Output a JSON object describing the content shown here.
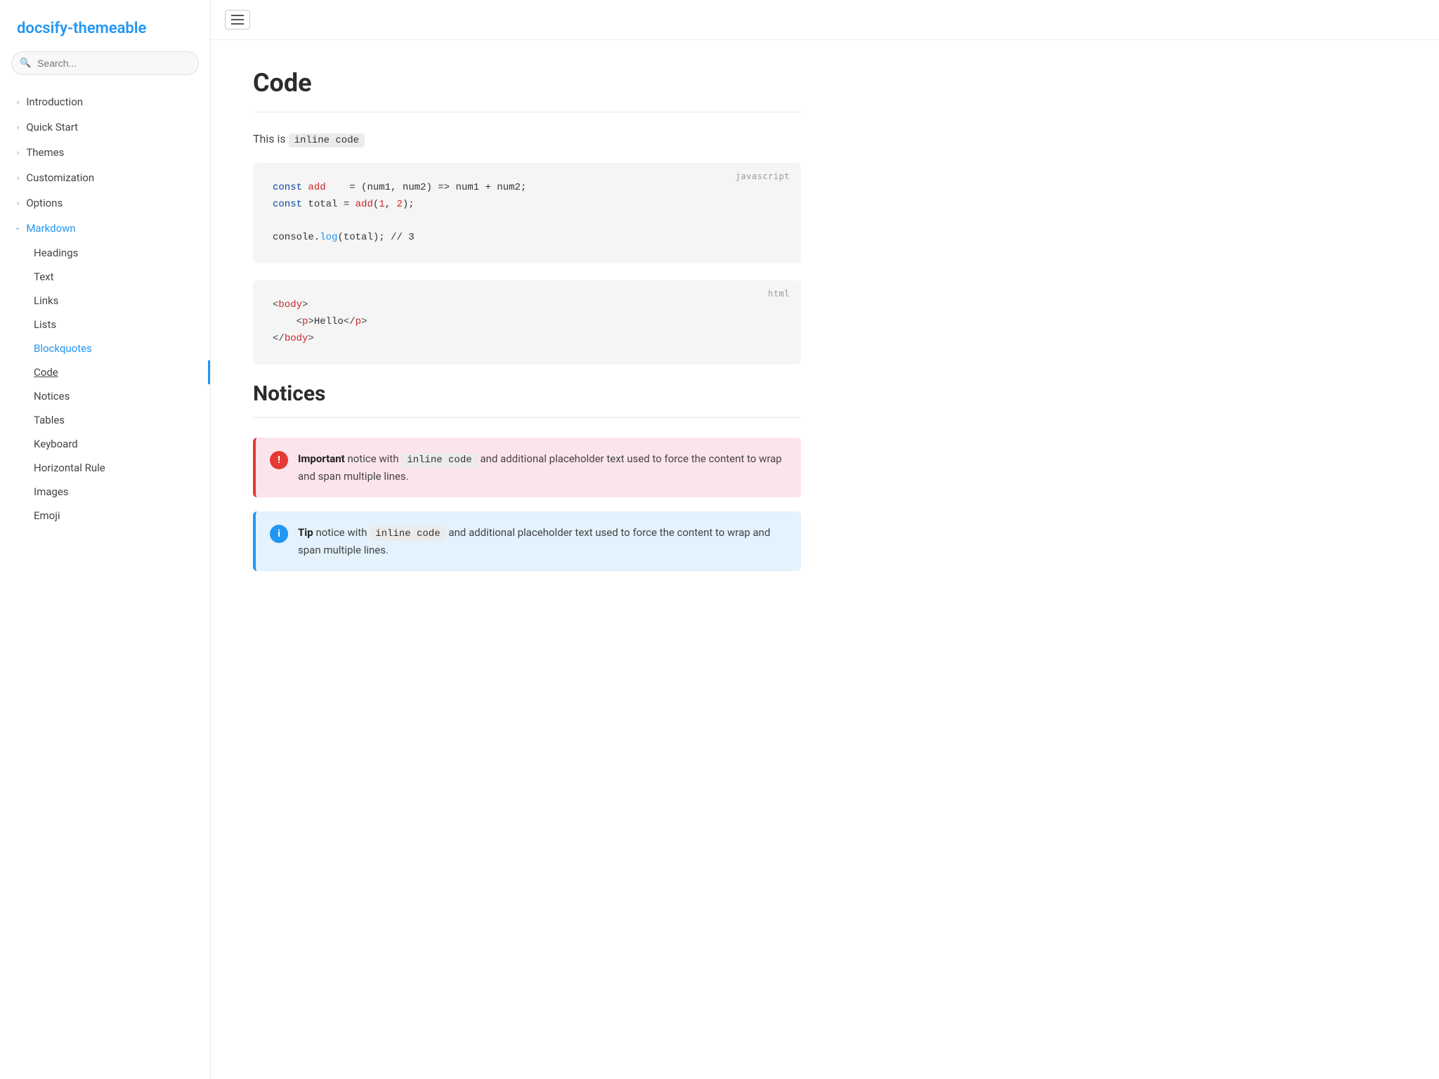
{
  "app": {
    "title": "docsify-themeable",
    "logo_href": "#"
  },
  "search": {
    "placeholder": "Search..."
  },
  "sidebar": {
    "nav": [
      {
        "id": "introduction",
        "label": "Introduction",
        "type": "parent",
        "open": false
      },
      {
        "id": "quick-start",
        "label": "Quick Start",
        "type": "parent",
        "open": false
      },
      {
        "id": "themes",
        "label": "Themes",
        "type": "parent",
        "open": false
      },
      {
        "id": "customization",
        "label": "Customization",
        "type": "parent",
        "open": false
      },
      {
        "id": "options",
        "label": "Options",
        "type": "parent",
        "open": false
      },
      {
        "id": "markdown",
        "label": "Markdown",
        "type": "parent",
        "open": true
      }
    ],
    "markdown_children": [
      {
        "id": "headings",
        "label": "Headings",
        "state": "normal"
      },
      {
        "id": "text",
        "label": "Text",
        "state": "normal"
      },
      {
        "id": "links",
        "label": "Links",
        "state": "normal"
      },
      {
        "id": "lists",
        "label": "Lists",
        "state": "normal"
      },
      {
        "id": "blockquotes",
        "label": "Blockquotes",
        "state": "highlighted"
      },
      {
        "id": "code",
        "label": "Code",
        "state": "underline"
      },
      {
        "id": "notices",
        "label": "Notices",
        "state": "normal"
      },
      {
        "id": "tables",
        "label": "Tables",
        "state": "normal"
      },
      {
        "id": "keyboard",
        "label": "Keyboard",
        "state": "normal"
      },
      {
        "id": "horizontal-rule",
        "label": "Horizontal Rule",
        "state": "normal"
      },
      {
        "id": "images",
        "label": "Images",
        "state": "normal"
      },
      {
        "id": "emoji",
        "label": "Emoji",
        "state": "normal"
      }
    ]
  },
  "topbar": {
    "hamburger_label": "menu"
  },
  "content": {
    "page_title": "Code",
    "inline_text_prefix": "This is",
    "inline_code": "inline code",
    "code_blocks": [
      {
        "lang": "javascript",
        "lines": [
          {
            "type": "js1",
            "raw": "const add    = (num1, num2) => num1 + num2;"
          },
          {
            "type": "js2",
            "raw": "const total = add(1, 2);"
          },
          {
            "type": "empty"
          },
          {
            "type": "js3",
            "raw": "console.log(total); // 3"
          }
        ]
      },
      {
        "lang": "html",
        "lines": [
          {
            "type": "html1",
            "raw": "<body>"
          },
          {
            "type": "html2",
            "raw": "    <p>Hello</p>"
          },
          {
            "type": "html3",
            "raw": "</body>"
          }
        ]
      }
    ],
    "notices_title": "Notices",
    "notices": [
      {
        "type": "important",
        "icon": "!",
        "bold": "Important",
        "text": " notice with",
        "inline_code": "inline code",
        "text2": "and additional placeholder text used to force the content to wrap and span multiple lines."
      },
      {
        "type": "tip",
        "icon": "i",
        "bold": "Tip",
        "text": " notice with",
        "inline_code": "inline code",
        "text2": "and additional placeholder text used to force the content to wrap and span multiple lines."
      }
    ]
  }
}
